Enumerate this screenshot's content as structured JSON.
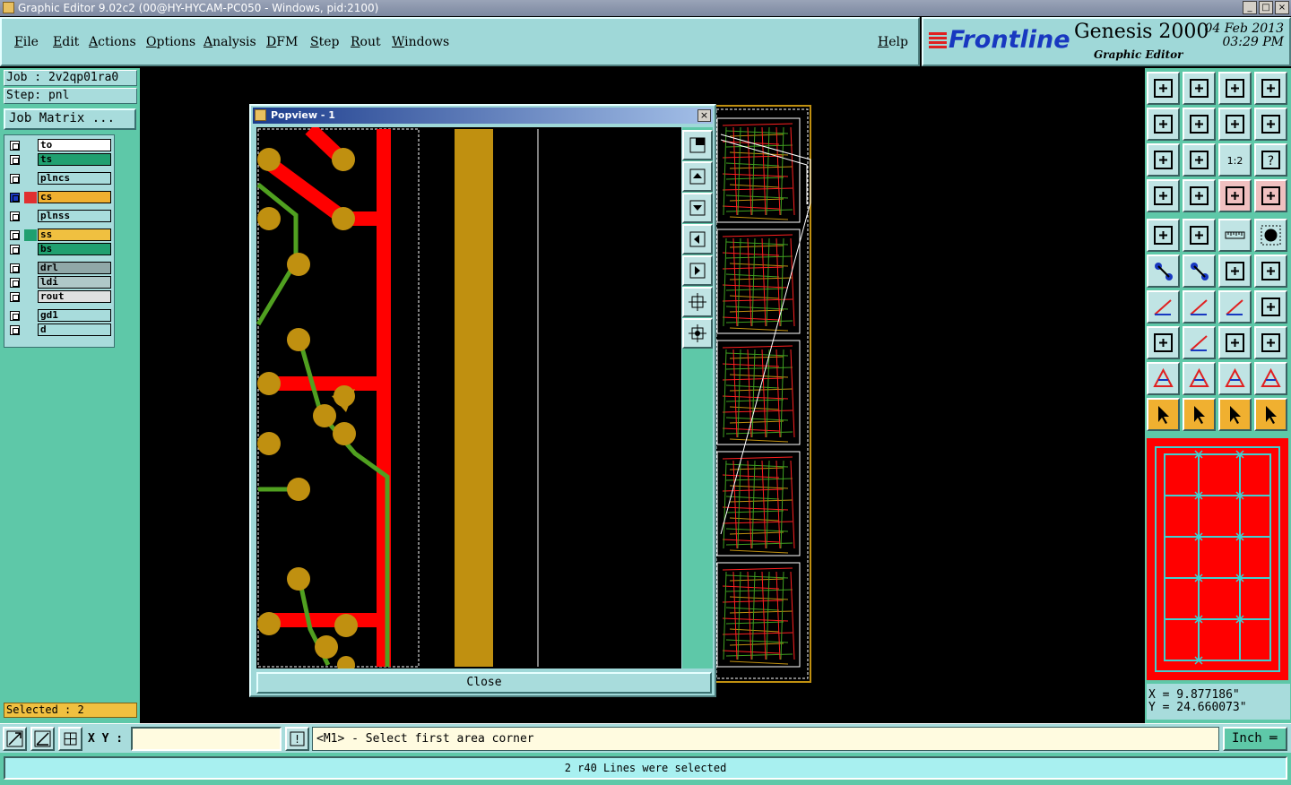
{
  "window": {
    "title": "Graphic Editor 9.02c2 (00@HY-HYCAM-PC050 - Windows, pid:2100)",
    "min": "_",
    "max": "□",
    "close": "×"
  },
  "menu": {
    "file": "File",
    "edit": "Edit",
    "actions": "Actions",
    "options": "Options",
    "analysis": "Analysis",
    "dfm": "DFM",
    "step": "Step",
    "rout": "Rout",
    "windows": "Windows",
    "help": "Help"
  },
  "brand": {
    "logo": "Frontline",
    "product": "Genesis 2000",
    "subtitle": "Graphic Editor",
    "date": "04 Feb 2013",
    "time": "03:29 PM"
  },
  "job": {
    "job": "Job : 2v2qp01ra0",
    "step": "Step: pnl",
    "matrix_button": "Job Matrix ..."
  },
  "layers": [
    {
      "name": "to",
      "color": "#ffffff",
      "swatch": "#a8dcdc"
    },
    {
      "name": "ts",
      "color": "#20a070",
      "swatch": "#a8dcdc"
    },
    {
      "name": "plncs",
      "color": "#a8dcdc",
      "swatch": "#a8dcdc"
    },
    {
      "name": "cs",
      "color": "#f0b030",
      "swatch": "#e03030",
      "active": true
    },
    {
      "name": "plnss",
      "color": "#a8dcdc",
      "swatch": "#a8dcdc"
    },
    {
      "name": "ss",
      "color": "#f0c040",
      "swatch": "#20a070"
    },
    {
      "name": "bs",
      "color": "#20a070",
      "swatch": "#a8dcdc"
    },
    {
      "name": "drl",
      "color": "#90a8a8",
      "swatch": "#a8dcdc"
    },
    {
      "name": "ldi",
      "color": "#b0c8c8",
      "swatch": "#a8dcdc"
    },
    {
      "name": "rout",
      "color": "#e0e0e0",
      "swatch": "#a8dcdc"
    },
    {
      "name": "gd1",
      "color": "#a8dcdc",
      "swatch": "#a8dcdc"
    },
    {
      "name": "d",
      "color": "#a8dcdc",
      "swatch": "#a8dcdc"
    }
  ],
  "selected": "Selected : 2",
  "popview": {
    "title": "Popview - 1",
    "close_label": "Close",
    "close_x": "×"
  },
  "coords": {
    "x": "X = 9.877186\"",
    "y": "Y = 24.660073\""
  },
  "command": {
    "xy_label": "X Y :",
    "xy_value": "",
    "prompt": "<M1> - Select first area corner",
    "unit": "Inch ═",
    "info_icon": "!"
  },
  "status": "2 r40 Lines were selected",
  "colors": {
    "panel": "#5ec8a8",
    "menu": "#9fd8d8",
    "copper_red": "#ff0000",
    "pad_gold": "#c09010",
    "trace_green": "#50a020"
  }
}
